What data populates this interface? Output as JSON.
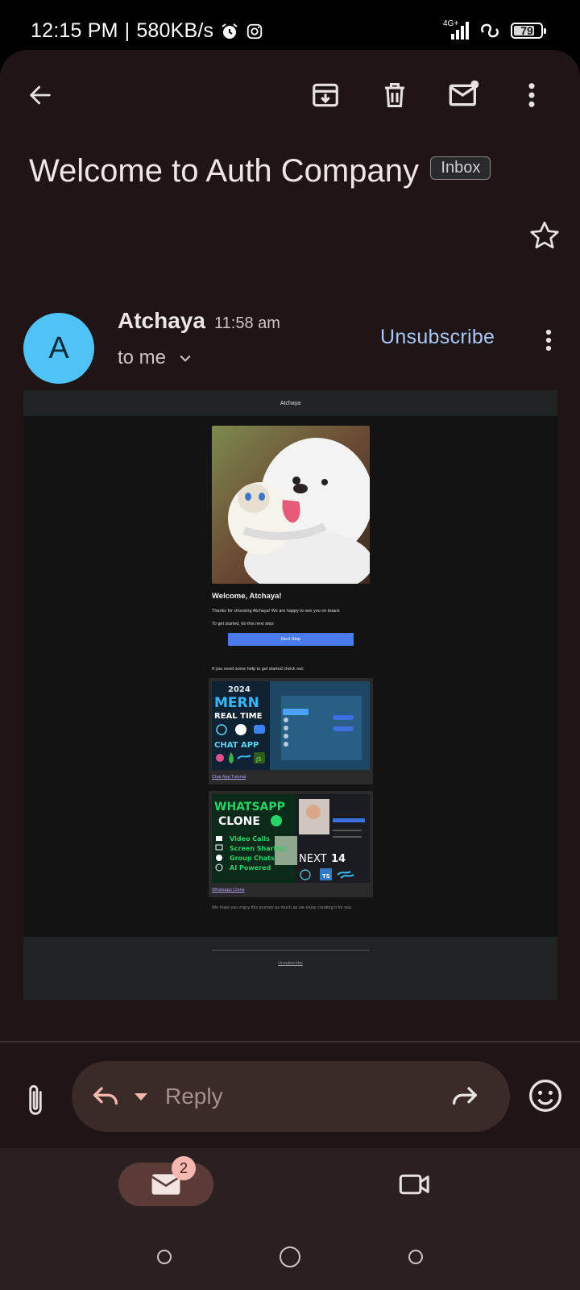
{
  "status_bar": {
    "time": "12:15 PM",
    "separator": "|",
    "speed": "580KB/s",
    "network": "4G+",
    "battery": "79",
    "battery_level_percent": 79,
    "icons": [
      "alarm-icon",
      "instagram-icon",
      "signal-icon",
      "link-icon",
      "battery-icon"
    ]
  },
  "toolbar": {
    "icons": [
      "back-arrow-icon",
      "archive-icon",
      "delete-icon",
      "mark-unread-icon",
      "more-vert-icon"
    ]
  },
  "message": {
    "subject": "Welcome to Auth Company",
    "label": "Inbox",
    "sender": {
      "initial": "A",
      "name": "Atchaya",
      "time": "11:58 am",
      "recipient": "to me"
    },
    "unsubscribe": "Unsubscribe"
  },
  "email_body": {
    "header_brand": "Atchaya",
    "greeting": "Welcome, Atchaya!",
    "intro": "Thanks for choosing Atchaya! We are happy to see you on board.",
    "next_step_prompt": "To get started, do this next step:",
    "next_step_button": "Next Step",
    "help_text": "If you need some help to get started check out:",
    "cards": [
      {
        "link": "Chat App Tutorial",
        "thumb": {
          "year": "2024",
          "line1": "MERN",
          "line2": "REAL TIME",
          "line3": "CHAT APP",
          "badge": "JS"
        }
      },
      {
        "link": "Whatsapp Clone",
        "thumb": {
          "line1": "WHATSAPP",
          "line2": "CLONE",
          "features": [
            "Video Calls",
            "Screen Sharing",
            "Group Chats",
            "AI Powered"
          ],
          "next": "NEXT",
          "version": "14",
          "ts": "TS"
        }
      }
    ],
    "closing": "We hope you enjoy this journey as much as we enjoy creating it for you.",
    "footer_unsubscribe": "Unsubscribe"
  },
  "compose": {
    "reply": "Reply",
    "icons": [
      "attach-icon",
      "reply-icon",
      "caret-down-icon",
      "forward-icon",
      "emoji-icon"
    ]
  },
  "bottom_nav": {
    "mail_badge": "2",
    "icons": [
      "mail-icon",
      "video-call-icon"
    ]
  },
  "colors": {
    "background": "#1e1514",
    "avatar": "#4fc3f7",
    "link": "#a8c7fa",
    "email_button": "#4b7bea",
    "badge": "#f5b7ae"
  }
}
